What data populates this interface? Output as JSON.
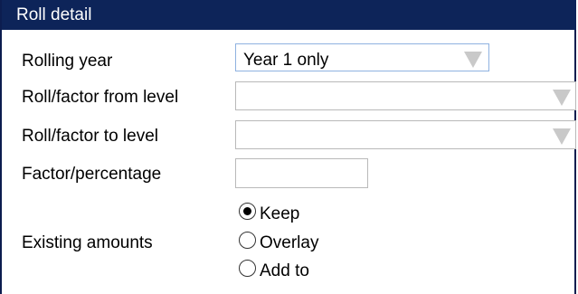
{
  "panel": {
    "title": "Roll detail"
  },
  "rows": {
    "rolling_year": {
      "label": "Rolling year",
      "value": "Year 1 only"
    },
    "roll_from": {
      "label": "Roll/factor from level",
      "value": ""
    },
    "roll_to": {
      "label": "Roll/factor to level",
      "value": ""
    },
    "factor": {
      "label": "Factor/percentage",
      "value": ""
    },
    "existing_amounts": {
      "label": "Existing amounts",
      "options": [
        "Keep",
        "Overlay",
        "Add to"
      ],
      "selected": "Keep"
    }
  }
}
